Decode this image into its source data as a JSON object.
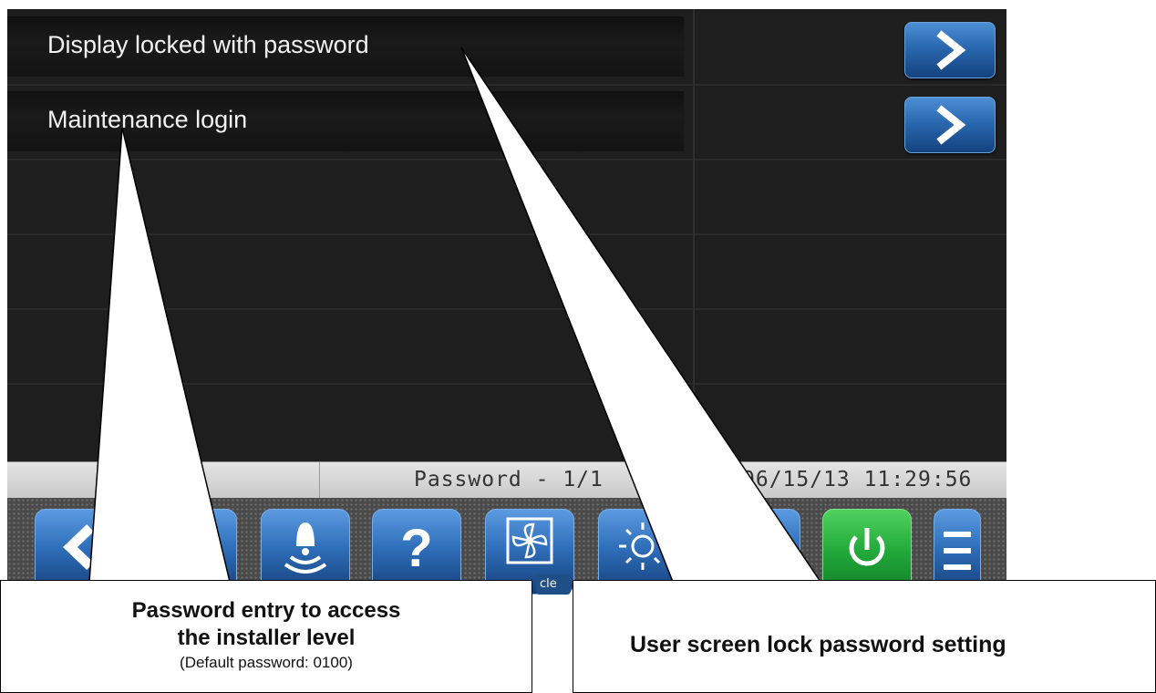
{
  "menu": {
    "items": [
      {
        "label": "Display locked with password"
      },
      {
        "label": "Maintenance login"
      }
    ]
  },
  "status_bar": {
    "page": "Password - 1/1",
    "datetime": "06/15/13  11:29:56"
  },
  "toolbar": {
    "buttons": [
      "back-icon",
      "user-icon",
      "alarm-bell-icon",
      "help-icon",
      "fan-icon",
      "sun-icon",
      "schedule-icon",
      "power-icon",
      "menu-icon"
    ],
    "partial_tag": "cle"
  },
  "callouts": {
    "left_title_line1": "Password entry to access",
    "left_title_line2": "the installer level",
    "left_note": "(Default password: 0100)",
    "right_title": "User screen lock password setting"
  },
  "colors": {
    "screen_bg": "#1e1e1e",
    "button_blue": "#2f6fba",
    "power_green": "#22a93a"
  }
}
